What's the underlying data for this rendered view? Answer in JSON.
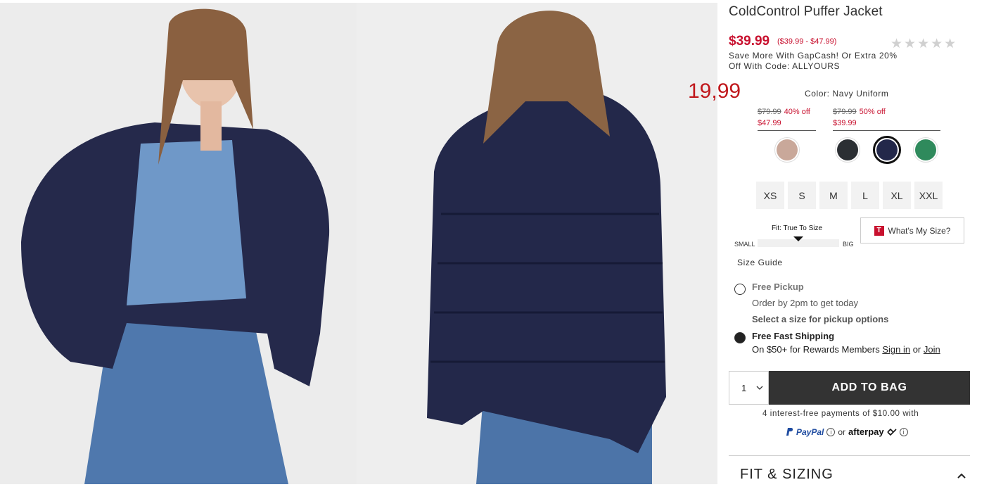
{
  "product": {
    "title": "ColdControl Puffer Jacket",
    "price": "$39.99",
    "price_range": "($39.99 - $47.99)",
    "promo": "Save More With GapCash! Or Extra 20% Off With Code: ALLYOURS",
    "rating_stars": "★★★★★"
  },
  "overlay_price": "19,99",
  "color": {
    "label": "Color: Navy Uniform",
    "groups": [
      {
        "old": "$79.99",
        "off": "40% off",
        "new": "$47.99"
      },
      {
        "old": "$79.99",
        "off": "50% off",
        "new": "$39.99"
      }
    ],
    "swatches": [
      {
        "name": "tan",
        "hex": "#c9a89a"
      },
      {
        "name": "black",
        "hex": "#2b2f33"
      },
      {
        "name": "navy",
        "hex": "#23284a",
        "selected": true
      },
      {
        "name": "green",
        "hex": "#2f8a5c"
      }
    ]
  },
  "sizes": [
    "XS",
    "S",
    "M",
    "L",
    "XL",
    "XXL"
  ],
  "fit": {
    "label": "Fit: True To Size",
    "small": "SMALL",
    "big": "BIG",
    "whats_my_size": "What's My Size?",
    "size_guide": "Size Guide"
  },
  "shipping": {
    "pickup_title": "Free Pickup",
    "pickup_sub": "Order by 2pm to get today",
    "pickup_select": "Select a size for pickup options",
    "ship_title": "Free Fast Shipping",
    "ship_sub_prefix": "On $50+ for Rewards Members ",
    "sign_in": "Sign in",
    "or": " or ",
    "join": "Join"
  },
  "cart": {
    "qty": "1",
    "add_to_bag": "ADD TO BAG"
  },
  "payments": {
    "installments": "4 interest-free payments of $10.00 with",
    "paypal": "PayPal",
    "or": "or",
    "afterpay": "afterpay"
  },
  "sections": {
    "fit_sizing": "FIT & SIZING"
  },
  "colors": {
    "accent_red": "#c8102e",
    "button_dark": "#333333",
    "jacket_navy": "#23284a"
  }
}
